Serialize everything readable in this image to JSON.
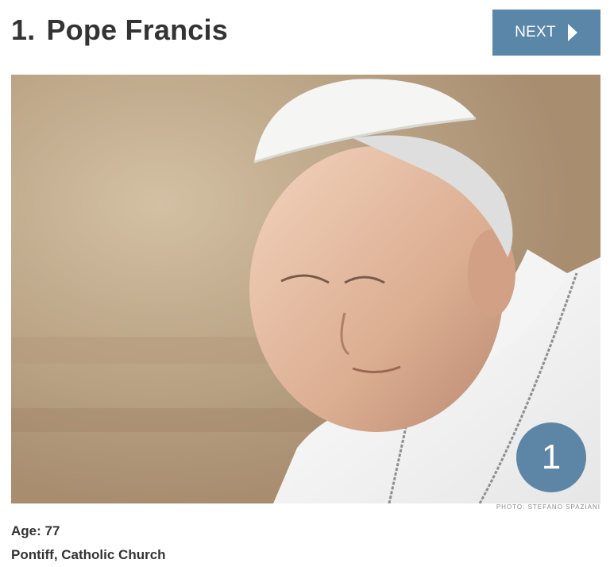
{
  "slide": {
    "rank": "1.",
    "name": "Pope Francis",
    "next_label": "NEXT",
    "badge_number": "1",
    "photo_credit": "PHOTO: STEFANO SPAZIANI",
    "age_label": "Age: 77",
    "title_line": "Pontiff, Catholic Church"
  },
  "colors": {
    "accent": "#5a86a8",
    "badge": "#527ea0",
    "text": "#333333"
  },
  "icons": {
    "next": "chevron-right-icon"
  }
}
